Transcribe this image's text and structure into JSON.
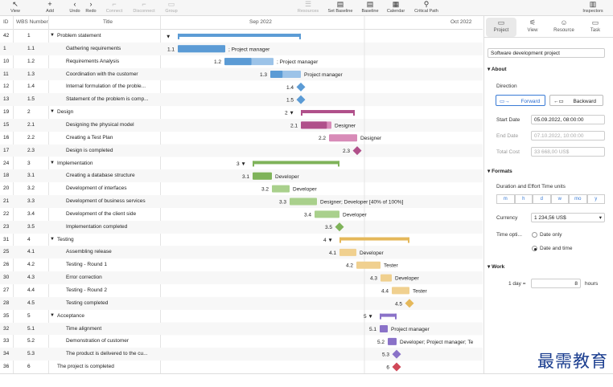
{
  "toolbar": {
    "items": [
      {
        "label": "View",
        "icon": "cursor-icon",
        "enabled": true
      },
      {
        "label": "Add",
        "icon": "plus-icon",
        "enabled": true
      },
      {
        "label": "Undo",
        "icon": "undo-icon",
        "enabled": true
      },
      {
        "label": "Redo",
        "icon": "redo-icon",
        "enabled": true
      },
      {
        "label": "Connect",
        "icon": "connect-icon",
        "enabled": false
      },
      {
        "label": "Disconnect",
        "icon": "disconnect-icon",
        "enabled": false
      },
      {
        "label": "Group",
        "icon": "group-icon",
        "enabled": false
      },
      {
        "label": "Resources",
        "icon": "resources-icon",
        "enabled": false
      },
      {
        "label": "Set Baseline",
        "icon": "set-baseline-icon",
        "enabled": true
      },
      {
        "label": "Baseline",
        "icon": "baseline-icon",
        "enabled": true
      },
      {
        "label": "Calendar",
        "icon": "calendar-icon",
        "enabled": true
      },
      {
        "label": "Critical Path",
        "icon": "critical-path-icon",
        "enabled": true
      },
      {
        "label": "Inspectors",
        "icon": "inspectors-icon",
        "enabled": true
      }
    ]
  },
  "grid": {
    "headers": {
      "id": "ID",
      "wbs": "WBS Number",
      "title": "Title"
    },
    "months": [
      "Sep 2022",
      "Oct 2022"
    ],
    "rows": [
      {
        "id": "42",
        "wbs": "1",
        "title": "Problem statement",
        "summary": true,
        "indent": 0
      },
      {
        "id": "1",
        "wbs": "1.1",
        "title": "Gathering requirements",
        "summary": false,
        "indent": 1
      },
      {
        "id": "10",
        "wbs": "1.2",
        "title": "Requirements Analysis",
        "summary": false,
        "indent": 1
      },
      {
        "id": "11",
        "wbs": "1.3",
        "title": "Coordination with the customer",
        "summary": false,
        "indent": 1
      },
      {
        "id": "12",
        "wbs": "1.4",
        "title": "Internal formulation of the proble...",
        "summary": false,
        "indent": 1
      },
      {
        "id": "13",
        "wbs": "1.5",
        "title": "Statement of the problem is comp...",
        "summary": false,
        "indent": 1
      },
      {
        "id": "19",
        "wbs": "2",
        "title": "Design",
        "summary": true,
        "indent": 0
      },
      {
        "id": "15",
        "wbs": "2.1",
        "title": "Designing the physical model",
        "summary": false,
        "indent": 1
      },
      {
        "id": "16",
        "wbs": "2.2",
        "title": "Creating a Test Plan",
        "summary": false,
        "indent": 1
      },
      {
        "id": "17",
        "wbs": "2.3",
        "title": "Design is completed",
        "summary": false,
        "indent": 1
      },
      {
        "id": "24",
        "wbs": "3",
        "title": "Implementation",
        "summary": true,
        "indent": 0
      },
      {
        "id": "18",
        "wbs": "3.1",
        "title": "Creating a database structure",
        "summary": false,
        "indent": 1
      },
      {
        "id": "20",
        "wbs": "3.2",
        "title": "Development of interfaces",
        "summary": false,
        "indent": 1
      },
      {
        "id": "21",
        "wbs": "3.3",
        "title": "Development of business services",
        "summary": false,
        "indent": 1
      },
      {
        "id": "22",
        "wbs": "3.4",
        "title": "Development of the client side",
        "summary": false,
        "indent": 1
      },
      {
        "id": "23",
        "wbs": "3.5",
        "title": "Implementation completed",
        "summary": false,
        "indent": 1
      },
      {
        "id": "31",
        "wbs": "4",
        "title": "Testing",
        "summary": true,
        "indent": 0
      },
      {
        "id": "25",
        "wbs": "4.1",
        "title": "Assembling release",
        "summary": false,
        "indent": 1
      },
      {
        "id": "26",
        "wbs": "4.2",
        "title": "Testing - Round 1",
        "summary": false,
        "indent": 1
      },
      {
        "id": "30",
        "wbs": "4.3",
        "title": "Error correction",
        "summary": false,
        "indent": 1
      },
      {
        "id": "27",
        "wbs": "4.4",
        "title": "Testing - Round 2",
        "summary": false,
        "indent": 1
      },
      {
        "id": "28",
        "wbs": "4.5",
        "title": "Testing completed",
        "summary": false,
        "indent": 1
      },
      {
        "id": "35",
        "wbs": "5",
        "title": "Acceptance",
        "summary": true,
        "indent": 0
      },
      {
        "id": "32",
        "wbs": "5.1",
        "title": "Time alignment",
        "summary": false,
        "indent": 1
      },
      {
        "id": "33",
        "wbs": "5.2",
        "title": "Demonstration of customer",
        "summary": false,
        "indent": 1
      },
      {
        "id": "34",
        "wbs": "5.3",
        "title": "The product is delivered to the cu...",
        "summary": false,
        "indent": 1
      },
      {
        "id": "36",
        "wbs": "6",
        "title": "The project is completed",
        "summary": false,
        "indent": 0
      }
    ]
  },
  "gantt": {
    "colors": {
      "blue": "#5b9bd5",
      "blue_light": "#9cc3e8",
      "pink": "#b0508a",
      "pink_light": "#d88bb8",
      "green": "#7fb35a",
      "green_light": "#a9d08c",
      "yellow": "#e5b85a",
      "yellow_light": "#f0d08f",
      "purple": "#8a72c8",
      "red": "#d04858"
    },
    "bars": [
      {
        "row": 0,
        "type": "summary",
        "color": "blue",
        "start": 21,
        "end": 174,
        "label": "",
        "wbs": ""
      },
      {
        "row": 1,
        "type": "task",
        "color": "blue",
        "start": 21,
        "end": 80,
        "progress": 1.0,
        "wbs": "1.1",
        "label": "; Project manager"
      },
      {
        "row": 2,
        "type": "task",
        "color": "blue",
        "start": 79,
        "end": 140,
        "progress": 0.55,
        "wbs": "1.2",
        "label": "; Project manager"
      },
      {
        "row": 3,
        "type": "task",
        "color": "blue",
        "start": 136,
        "end": 174,
        "progress": 0.4,
        "wbs": "1.3",
        "label": "Project manager"
      },
      {
        "row": 4,
        "type": "milestone",
        "color": "blue",
        "start": 174,
        "wbs": "1.4",
        "label": ""
      },
      {
        "row": 5,
        "type": "milestone",
        "color": "blue",
        "start": 174,
        "wbs": "1.5",
        "label": ""
      },
      {
        "row": 6,
        "type": "summary",
        "color": "pink",
        "start": 174,
        "end": 241,
        "label": "",
        "wbs": "2"
      },
      {
        "row": 7,
        "type": "task",
        "color": "pink",
        "start": 174,
        "end": 212,
        "progress": 0.85,
        "wbs": "2.1",
        "label": "Designer"
      },
      {
        "row": 8,
        "type": "task",
        "color": "pink",
        "start": 209,
        "end": 244,
        "progress": 0.0,
        "wbs": "2.2",
        "label": "Designer"
      },
      {
        "row": 9,
        "type": "milestone",
        "color": "pink",
        "start": 244,
        "wbs": "2.3",
        "label": ""
      },
      {
        "row": 10,
        "type": "summary",
        "color": "green",
        "start": 114,
        "end": 222,
        "label": "",
        "wbs": "3"
      },
      {
        "row": 11,
        "type": "task",
        "color": "green",
        "start": 114,
        "end": 138,
        "progress": 1.0,
        "wbs": "3.1",
        "label": "Developer"
      },
      {
        "row": 12,
        "type": "task",
        "color": "green",
        "start": 138,
        "end": 160,
        "progress": 0.0,
        "wbs": "3.2",
        "label": "Developer"
      },
      {
        "row": 13,
        "type": "task",
        "color": "green",
        "start": 160,
        "end": 194,
        "progress": 0.0,
        "wbs": "3.3",
        "label": "Designer; Developer [40% of 100%]"
      },
      {
        "row": 14,
        "type": "task",
        "color": "green",
        "start": 191,
        "end": 222,
        "progress": 0.0,
        "wbs": "3.4",
        "label": "Developer"
      },
      {
        "row": 15,
        "type": "milestone",
        "color": "green",
        "start": 222,
        "wbs": "3.5",
        "label": ""
      },
      {
        "row": 16,
        "type": "summary",
        "color": "yellow",
        "start": 222,
        "end": 309,
        "label": "",
        "wbs": "4"
      },
      {
        "row": 17,
        "type": "task",
        "color": "yellow",
        "start": 222,
        "end": 243,
        "progress": 0.0,
        "wbs": "4.1",
        "label": "Developer"
      },
      {
        "row": 18,
        "type": "task",
        "color": "yellow",
        "start": 243,
        "end": 273,
        "progress": 0.0,
        "wbs": "4.2",
        "label": "Tester"
      },
      {
        "row": 19,
        "type": "task",
        "color": "yellow",
        "start": 273,
        "end": 287,
        "progress": 0.0,
        "wbs": "4.3",
        "label": "Developer"
      },
      {
        "row": 20,
        "type": "task",
        "color": "yellow",
        "start": 287,
        "end": 309,
        "progress": 0.0,
        "wbs": "4.4",
        "label": "Tester"
      },
      {
        "row": 21,
        "type": "milestone",
        "color": "yellow",
        "start": 309,
        "wbs": "4.5",
        "label": ""
      },
      {
        "row": 22,
        "type": "summary",
        "color": "purple",
        "start": 272,
        "end": 293,
        "label": "",
        "wbs": "5"
      },
      {
        "row": 23,
        "type": "task",
        "color": "purple",
        "start": 272,
        "end": 282,
        "progress": 0.0,
        "wbs": "5.1",
        "label": "Project manager"
      },
      {
        "row": 24,
        "type": "task",
        "color": "purple",
        "start": 282,
        "end": 293,
        "progress": 0.0,
        "wbs": "5.2",
        "label": "Developer; Project manager; Te"
      },
      {
        "row": 25,
        "type": "milestone",
        "color": "purple",
        "start": 293,
        "wbs": "5.3",
        "label": ""
      },
      {
        "row": 26,
        "type": "milestone",
        "color": "red",
        "start": 293,
        "wbs": "6",
        "label": ""
      }
    ]
  },
  "inspector": {
    "tabs": [
      {
        "label": "Project",
        "icon": "project-icon",
        "active": true
      },
      {
        "label": "View",
        "icon": "view-sliders-icon",
        "active": false
      },
      {
        "label": "Resource",
        "icon": "resource-icon",
        "active": false
      },
      {
        "label": "Task",
        "icon": "task-icon",
        "active": false
      }
    ],
    "project_name": "Software development project",
    "about": {
      "section": "About",
      "direction_label": "Direction",
      "forward": "Forward",
      "backward": "Backward",
      "start_date_label": "Start Date",
      "start_date": "05.09.2022, 08:00:00",
      "end_date_label": "End Date",
      "end_date": "07.10.2022, 10:00:00",
      "total_cost_label": "Total Cost",
      "total_cost": "33 668,00 US$"
    },
    "formats": {
      "section": "Formats",
      "duration_label": "Duration and Effort Time units",
      "units": [
        "m",
        "h",
        "d",
        "w",
        "mo",
        "y"
      ],
      "currency_label": "Currency",
      "currency": "1 234,56 US$",
      "time_label": "Time opti...",
      "date_only": "Date only",
      "date_and_time": "Date and time"
    },
    "work": {
      "section": "Work",
      "day_label": "1 day =",
      "day_value": "8",
      "unit": "hours"
    }
  },
  "watermark": "最需教育"
}
